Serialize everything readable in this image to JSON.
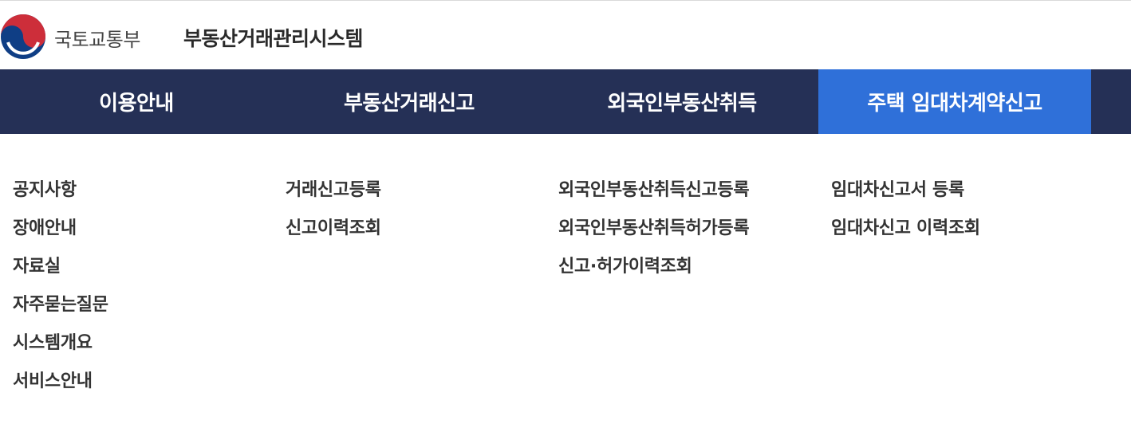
{
  "header": {
    "ministry": "국토교통부",
    "system_title": "부동산거래관리시스템"
  },
  "nav": {
    "tabs": [
      {
        "label": "이용안내"
      },
      {
        "label": "부동산거래신고"
      },
      {
        "label": "외국인부동산취득"
      },
      {
        "label": "주택 임대차계약신고",
        "active": true
      }
    ]
  },
  "submenu": {
    "columns": [
      {
        "items": [
          "공지사항",
          "장애안내",
          "자료실",
          "자주묻는질문",
          "시스템개요",
          "서비스안내"
        ]
      },
      {
        "items": [
          "거래신고등록",
          "신고이력조회"
        ]
      },
      {
        "items": [
          "외국인부동산취득신고등록",
          "외국인부동산취득허가등록",
          "신고·허가이력조회"
        ]
      },
      {
        "items": [
          "임대차신고서 등록",
          "임대차신고 이력조회"
        ]
      }
    ]
  },
  "colors": {
    "nav_bg": "#253056",
    "nav_active_bg": "#2f70d9",
    "logo_red": "#cd2e3a",
    "logo_blue": "#0f3e85"
  }
}
